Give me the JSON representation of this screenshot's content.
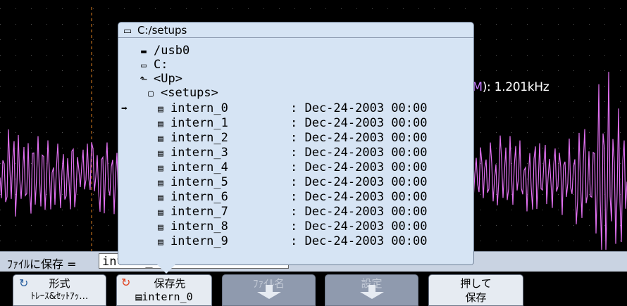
{
  "measurement": {
    "prefix": "(",
    "channel": "M",
    "suffix": "): 1.201kHz"
  },
  "dialog": {
    "title": "C:/setups",
    "tree": {
      "usb": "/usb0",
      "drive": "C:",
      "up": "<Up>",
      "folder": "<setups>"
    },
    "files": [
      {
        "name": "intern_0",
        "date": ": Dec-24-2003 00:00"
      },
      {
        "name": "intern_1",
        "date": ": Dec-24-2003 00:00"
      },
      {
        "name": "intern_2",
        "date": ": Dec-24-2003 00:00"
      },
      {
        "name": "intern_3",
        "date": ": Dec-24-2003 00:00"
      },
      {
        "name": "intern_4",
        "date": ": Dec-24-2003 00:00"
      },
      {
        "name": "intern_5",
        "date": ": Dec-24-2003 00:00"
      },
      {
        "name": "intern_6",
        "date": ": Dec-24-2003 00:00"
      },
      {
        "name": "intern_7",
        "date": ": Dec-24-2003 00:00"
      },
      {
        "name": "intern_8",
        "date": ": Dec-24-2003 00:00"
      },
      {
        "name": "intern_9",
        "date": ": Dec-24-2003 00:00"
      }
    ]
  },
  "savebar": {
    "label": "ﾌｧｲﾙに保存 =",
    "value": "intern_0"
  },
  "softkeys": {
    "format": {
      "title": "形式",
      "sub": "ﾄﾚｰｽ&ｾｯﾄｱｯ…"
    },
    "dest": {
      "title": "保存先",
      "sub": "intern_0"
    },
    "filename": {
      "title": "ﾌｧｲﾙ名"
    },
    "settings": {
      "title": "設定"
    },
    "press": {
      "title": "押して",
      "sub": "保存"
    }
  },
  "colors": {
    "trace": "#e070f0",
    "marker": "#e08020",
    "dialog_bg": "#d6e4f4",
    "softkey_bg": "#e6ebf2"
  }
}
